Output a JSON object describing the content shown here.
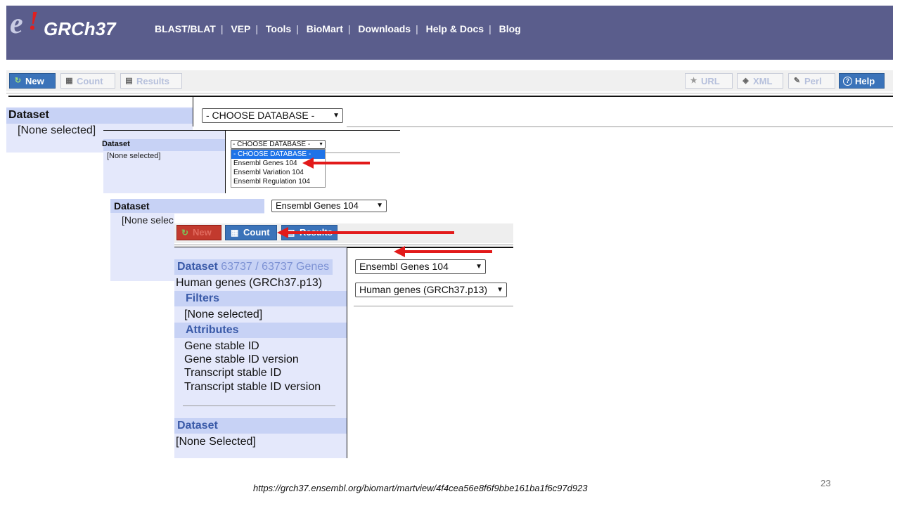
{
  "header": {
    "logo_e": "e",
    "logo_bang": "!",
    "logo_text": "GRCh37",
    "nav": [
      "BLAST/BLAT",
      "VEP",
      "Tools",
      "BioMart",
      "Downloads",
      "Help & Docs",
      "Blog"
    ]
  },
  "toolbar": {
    "new": "New",
    "count": "Count",
    "results": "Results",
    "url": "URL",
    "xml": "XML",
    "perl": "Perl",
    "help": "Help"
  },
  "panel1": {
    "dataset_label": "Dataset",
    "none_selected": "[None selected]",
    "select_value": "- CHOOSE DATABASE -"
  },
  "panel2": {
    "dataset_label": "Dataset",
    "none_selected": "[None selected]",
    "select_value": "- CHOOSE DATABASE -",
    "options": [
      "- CHOOSE DATABASE -",
      "Ensembl Genes 104",
      "Ensembl Variation 104",
      "Ensembl Regulation 104"
    ]
  },
  "panel3": {
    "dataset_label": "Dataset",
    "none_selected": "[None selec",
    "select_value": "Ensembl Genes 104"
  },
  "panel4": {
    "toolbar": {
      "new": "New",
      "count": "Count",
      "results": "Results"
    },
    "dataset_label": "Dataset",
    "dataset_count": "63737 / 63737 Genes",
    "dataset_name": "Human genes (GRCh37.p13)",
    "filters_label": "Filters",
    "filters_value": "[None selected]",
    "attributes_label": "Attributes",
    "attributes": [
      "Gene stable ID",
      "Gene stable ID version",
      "Transcript stable ID",
      "Transcript stable ID version"
    ],
    "dataset2_label": "Dataset",
    "dataset2_value": "[None Selected]",
    "select_database": "Ensembl Genes 104",
    "select_dataset": "Human genes (GRCh37.p13)"
  },
  "footer": {
    "url": "https://grch37.ensembl.org/biomart/martview/4f4cea56e8f6f9bbe161ba1f6c97d923",
    "page_number": "23"
  }
}
